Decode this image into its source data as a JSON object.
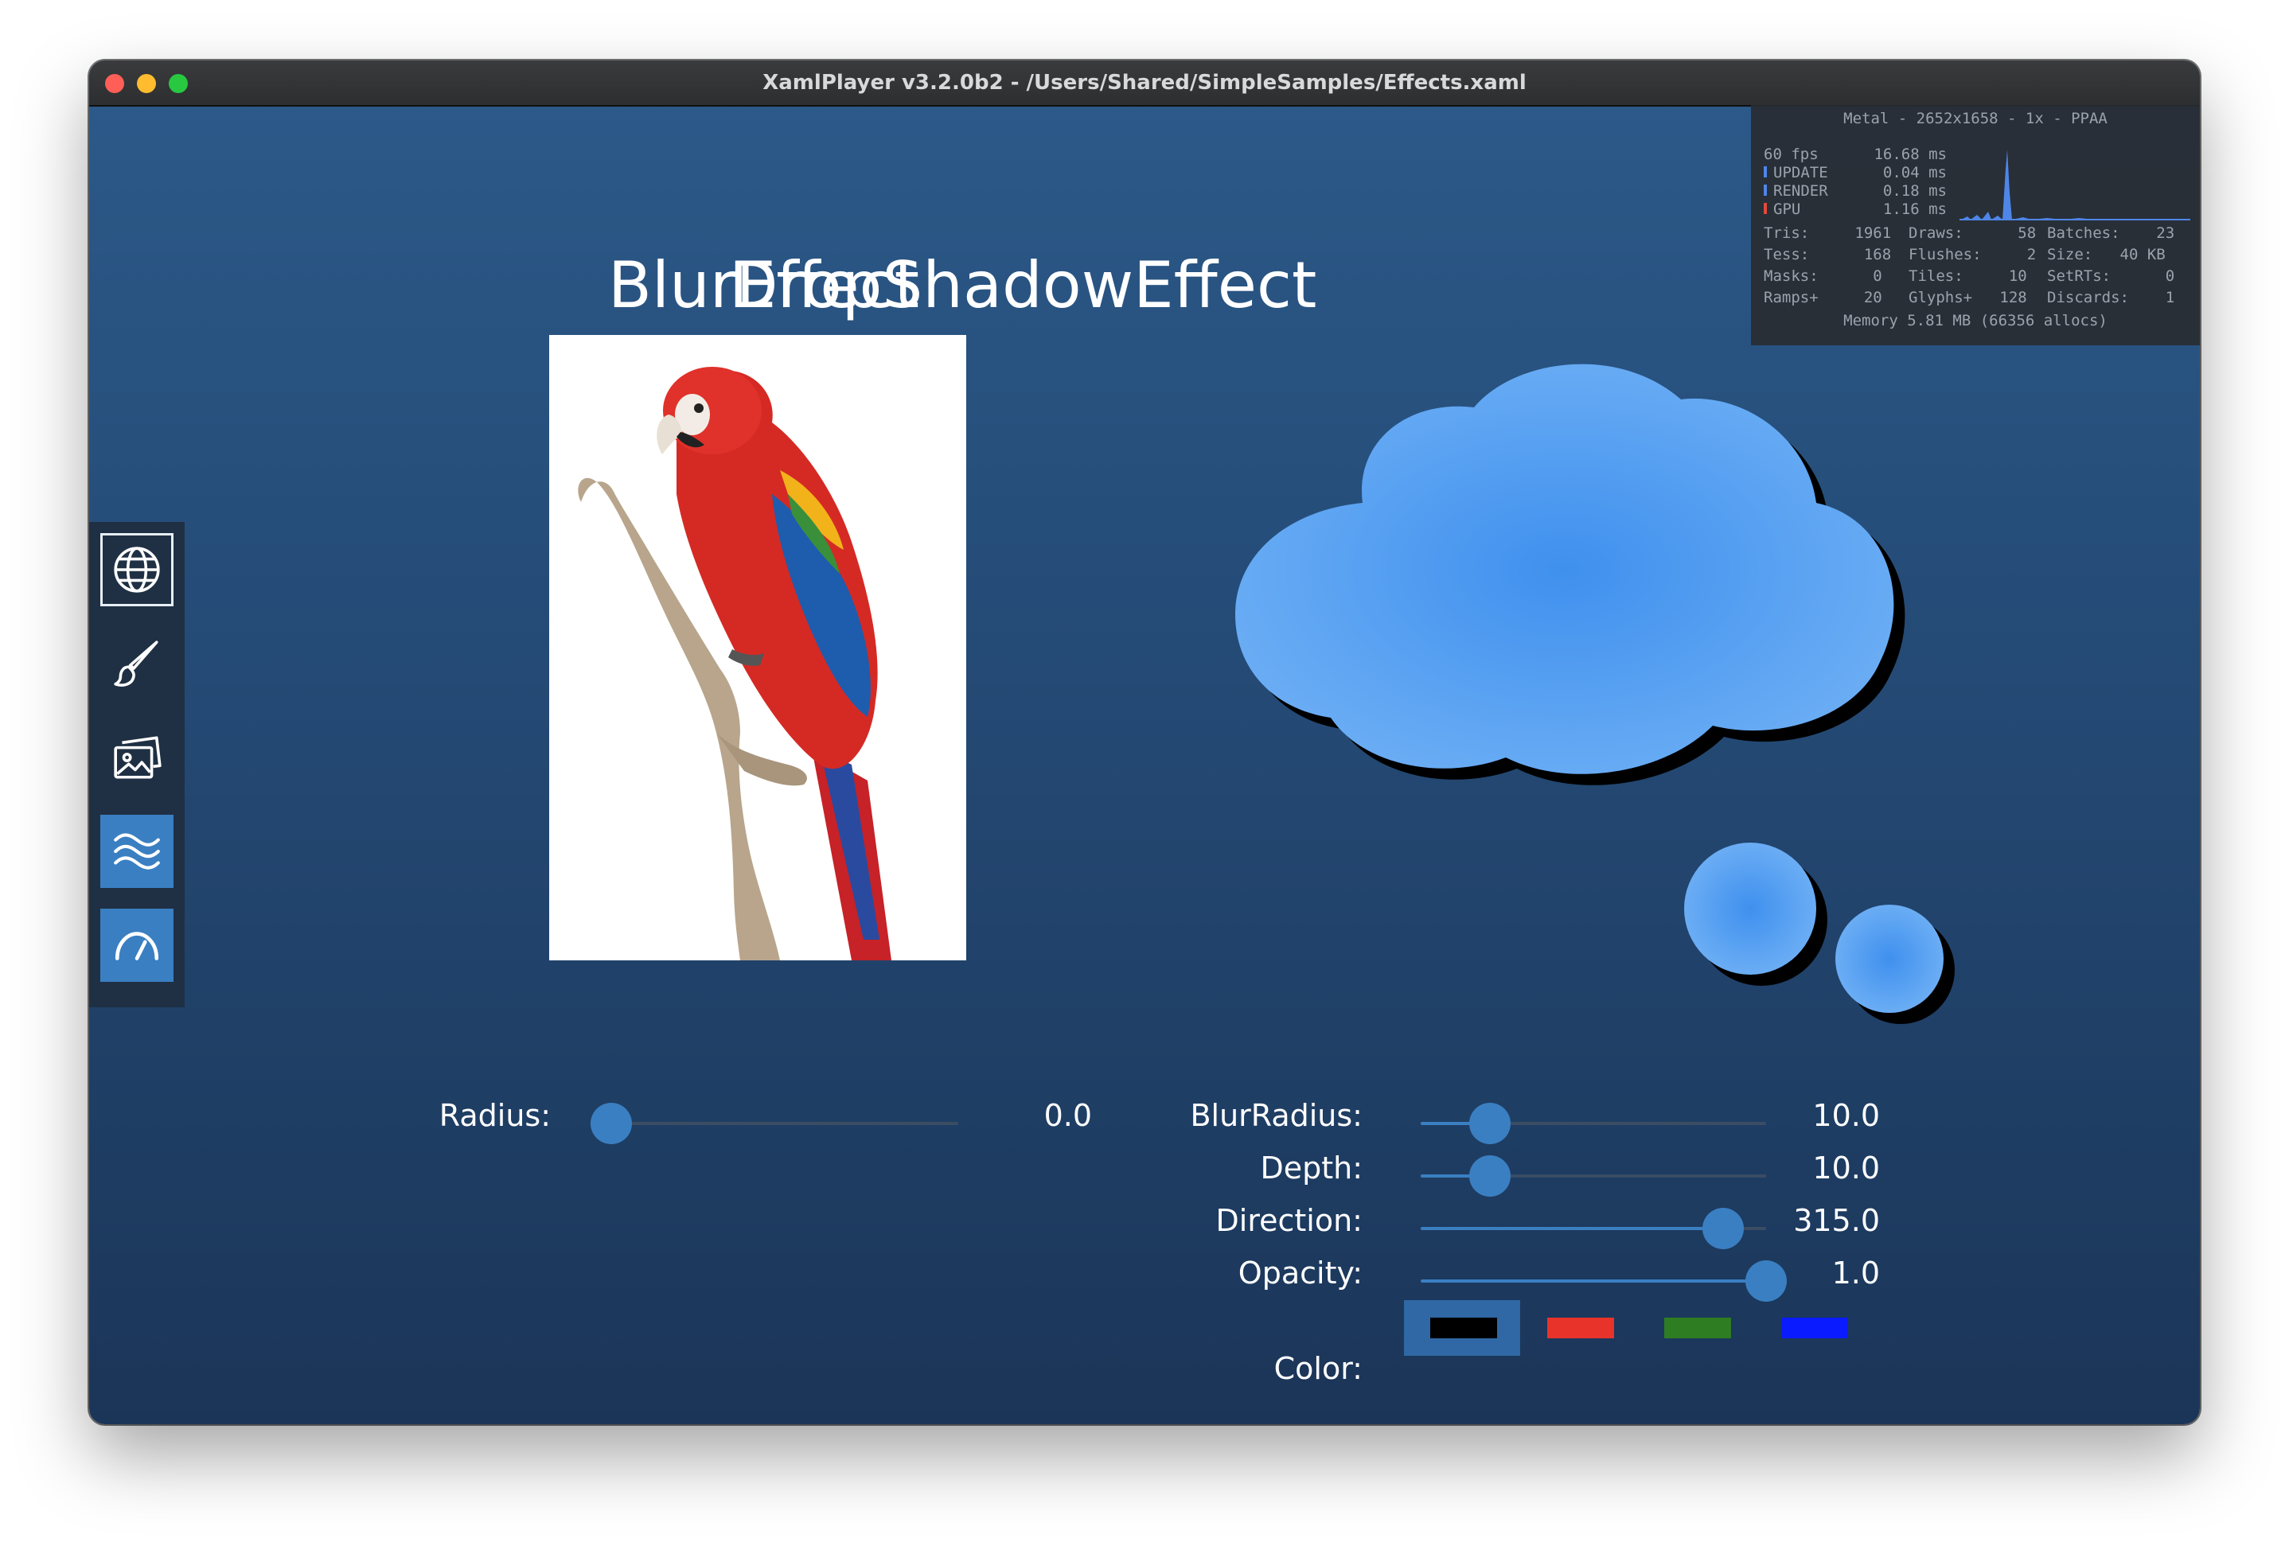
{
  "window": {
    "title": "XamlPlayer v3.2.0b2 - /Users/Shared/SimpleSamples/Effects.xaml",
    "traffic_lights": {
      "close": "#ff5f57",
      "minimize": "#febc2e",
      "zoom": "#28c840"
    }
  },
  "sidebar": {
    "items": [
      {
        "icon": "globe-icon",
        "selected": false
      },
      {
        "icon": "brush-icon",
        "selected": false
      },
      {
        "icon": "images-icon",
        "selected": false
      },
      {
        "icon": "waves-icon",
        "selected": true
      },
      {
        "icon": "gauge-icon",
        "selected": true
      }
    ]
  },
  "blur": {
    "heading": "BlurEffect",
    "radius_label": "Radius:",
    "radius_value": "0.0",
    "radius_fraction": 0.0
  },
  "dropshadow": {
    "heading": "DropShadowEffect",
    "blur_radius_label": "BlurRadius:",
    "blur_radius_value": "10.0",
    "blur_radius_fraction": 0.2,
    "depth_label": "Depth:",
    "depth_value": "10.0",
    "depth_fraction": 0.2,
    "direction_label": "Direction:",
    "direction_value": "315.0",
    "direction_fraction": 0.875,
    "opacity_label": "Opacity:",
    "opacity_value": "1.0",
    "opacity_fraction": 1.0,
    "color_label": "Color:",
    "colors": [
      {
        "name": "black",
        "hex": "#000000",
        "selected": true
      },
      {
        "name": "red",
        "hex": "#e8332a",
        "selected": false
      },
      {
        "name": "green",
        "hex": "#2e7d22",
        "selected": false
      },
      {
        "name": "blue",
        "hex": "#0a1cff",
        "selected": false
      }
    ]
  },
  "stats": {
    "header": "Metal - 2652x1658 - 1x - PPAA",
    "fps": "60 fps",
    "fps_ms": "16.68 ms",
    "update_label": "UPDATE",
    "update_ms": "0.04 ms",
    "render_label": "RENDER",
    "render_ms": "0.18 ms",
    "gpu_label": "GPU",
    "gpu_ms": "1.16 ms",
    "tris": "Tris:     1961",
    "draws": "Draws:      58",
    "batches": "Batches:    23",
    "tess": "Tess:      168",
    "flushes": "Flushes:     2",
    "size": "Size:   40 KB",
    "masks": "Masks:      0",
    "tiles": "Tiles:     10",
    "setrts": "SetRTs:      0",
    "ramps": "Ramps+     20",
    "glyphs": "Glyphs+   128",
    "discards": "Discards:    1",
    "memory": "Memory 5.81 MB (66356 allocs)"
  }
}
